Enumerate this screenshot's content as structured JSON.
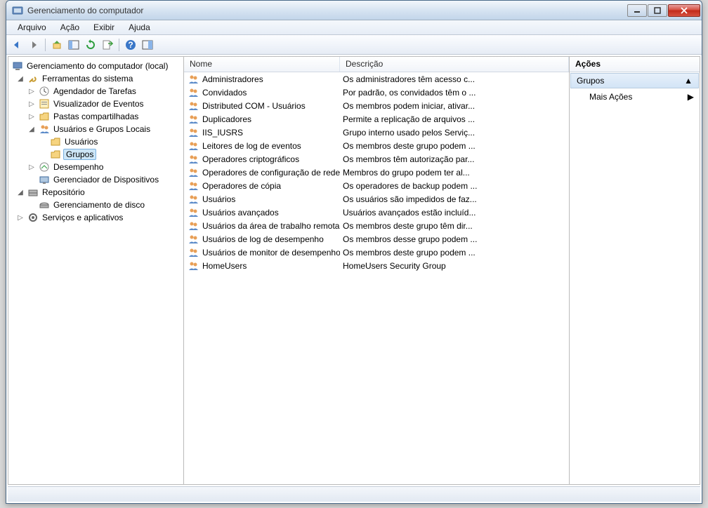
{
  "window": {
    "title": "Gerenciamento do computador"
  },
  "menu": {
    "arquivo": "Arquivo",
    "acao": "Ação",
    "exibir": "Exibir",
    "ajuda": "Ajuda"
  },
  "tree": {
    "root": "Gerenciamento do computador (local)",
    "sys_tools": "Ferramentas do sistema",
    "task_sched": "Agendador de Tarefas",
    "event_viewer": "Visualizador de Eventos",
    "shared": "Pastas compartilhadas",
    "users_groups": "Usuários e Grupos Locais",
    "users": "Usuários",
    "groups": "Grupos",
    "perf": "Desempenho",
    "dev_mgr": "Gerenciador de Dispositivos",
    "storage": "Repositório",
    "disk_mgmt": "Gerenciamento de disco",
    "services": "Serviços e aplicativos"
  },
  "columns": {
    "name": "Nome",
    "desc": "Descrição"
  },
  "groups": [
    {
      "name": "Administradores",
      "desc": "Os administradores têm acesso c..."
    },
    {
      "name": "Convidados",
      "desc": "Por padrão, os convidados têm o ..."
    },
    {
      "name": "Distributed COM - Usuários",
      "desc": "Os membros podem iniciar, ativar..."
    },
    {
      "name": "Duplicadores",
      "desc": "Permite a replicação de arquivos ..."
    },
    {
      "name": "IIS_IUSRS",
      "desc": "Grupo interno usado pelos Serviç..."
    },
    {
      "name": "Leitores de log de eventos",
      "desc": "Os membros deste grupo podem ..."
    },
    {
      "name": "Operadores criptográficos",
      "desc": "Os membros têm autorização par..."
    },
    {
      "name": "Operadores de configuração de rede",
      "desc": "Membros do grupo podem ter al..."
    },
    {
      "name": "Operadores de cópia",
      "desc": "Os operadores de backup podem ..."
    },
    {
      "name": "Usuários",
      "desc": "Os usuários são impedidos de faz..."
    },
    {
      "name": "Usuários avançados",
      "desc": "Usuários avançados estão incluíd..."
    },
    {
      "name": "Usuários da área de trabalho remota",
      "desc": "Os membros deste grupo têm dir..."
    },
    {
      "name": "Usuários de log de desempenho",
      "desc": "Os membros desse grupo podem ..."
    },
    {
      "name": "Usuários de monitor de desempenho",
      "desc": "Os membros deste grupo podem ..."
    },
    {
      "name": "HomeUsers",
      "desc": "HomeUsers Security Group"
    }
  ],
  "actions": {
    "header": "Ações",
    "section": "Grupos",
    "more": "Mais Ações"
  }
}
